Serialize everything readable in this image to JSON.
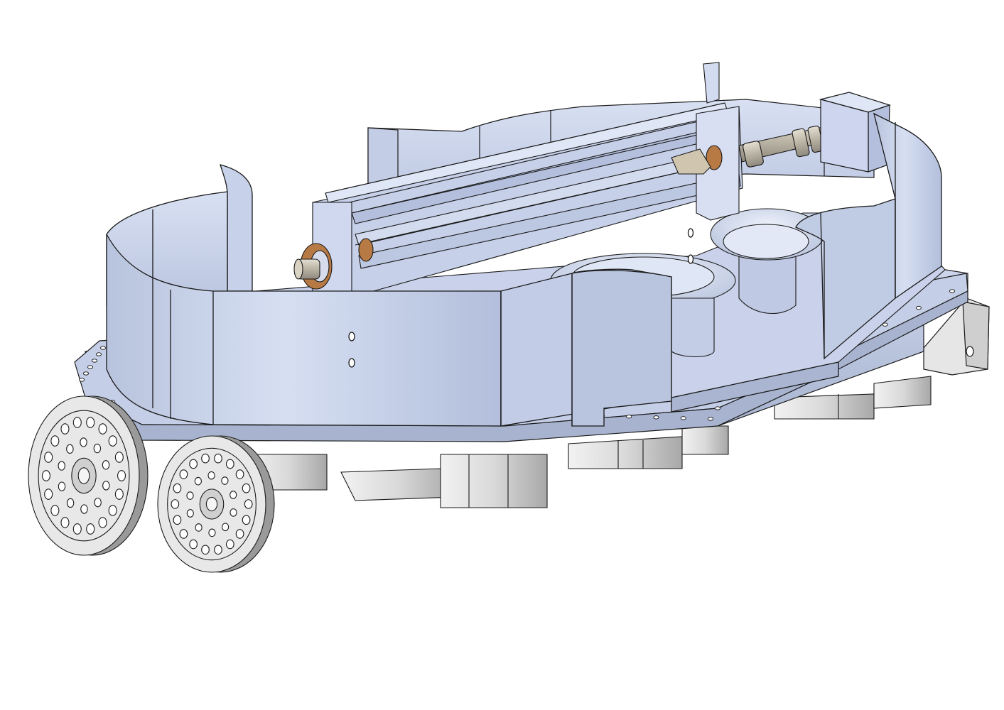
{
  "model": {
    "view": "isometric",
    "render_style": "shaded-with-edges",
    "colors": {
      "background": "#ffffff",
      "housing_light": "#d2dcf0",
      "housing_mid": "#bcc8e2",
      "housing_dark": "#a4b1cc",
      "housing_inner": "#c6d0e8",
      "edge": "#1a1a1a",
      "metal_light": "#ececec",
      "metal_mid": "#cfcfcf",
      "metal_dark": "#9a9a9a",
      "shaft": "#c9c4b8",
      "bronze": "#b87a44"
    },
    "parts": [
      "housing-wall",
      "mounting-flange",
      "rail-assembly",
      "shaft",
      "end-block",
      "bowl-left",
      "bowl-right",
      "wheel-left",
      "wheel-right",
      "support-bracket"
    ]
  }
}
